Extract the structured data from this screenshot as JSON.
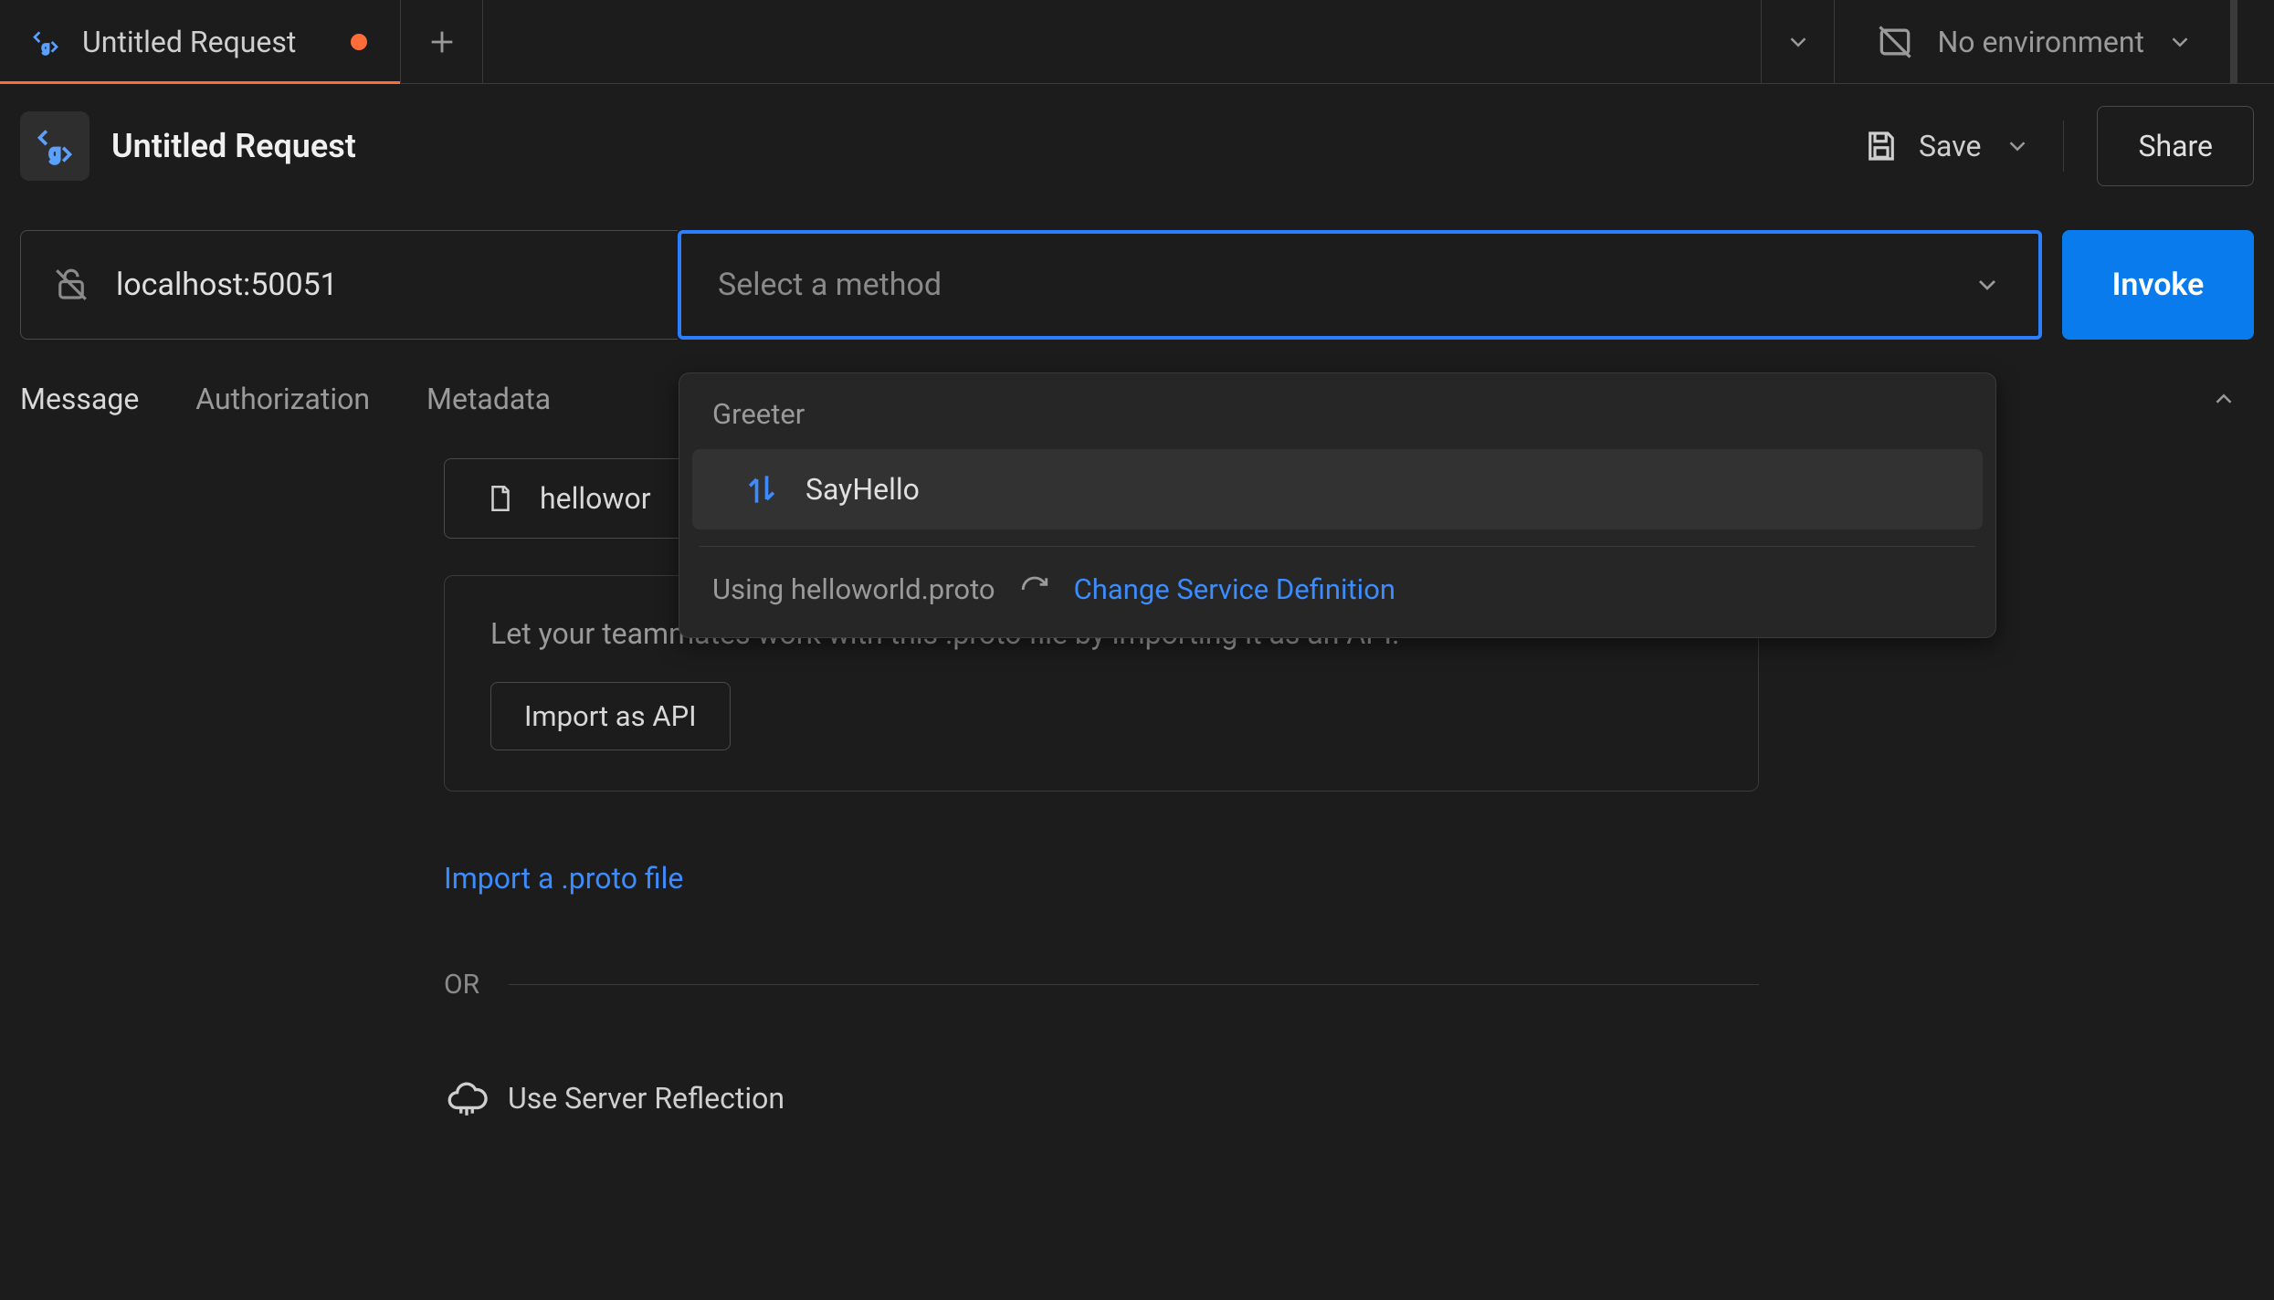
{
  "tabbar": {
    "active_tab_title": "Untitled Request",
    "env_label": "No environment"
  },
  "header": {
    "request_name": "Untitled Request",
    "save_label": "Save",
    "share_label": "Share"
  },
  "url_row": {
    "url_value": "localhost:50051",
    "method_placeholder": "Select a method",
    "invoke_label": "Invoke"
  },
  "req_tabs": {
    "message": "Message",
    "authorization": "Authorization",
    "metadata": "Metadata"
  },
  "method_dropdown": {
    "service": "Greeter",
    "method": "SayHello",
    "using_label": "Using helloworld.proto",
    "change_link": "Change Service Definition"
  },
  "body": {
    "proto_chip_partial": "hellowor",
    "import_panel_text": "Let your teammates work with this .proto file by importing it as an API.",
    "import_api_btn": "Import as API",
    "import_link": "Import a .proto file",
    "or_label": "OR",
    "reflection_label": "Use Server Reflection"
  }
}
